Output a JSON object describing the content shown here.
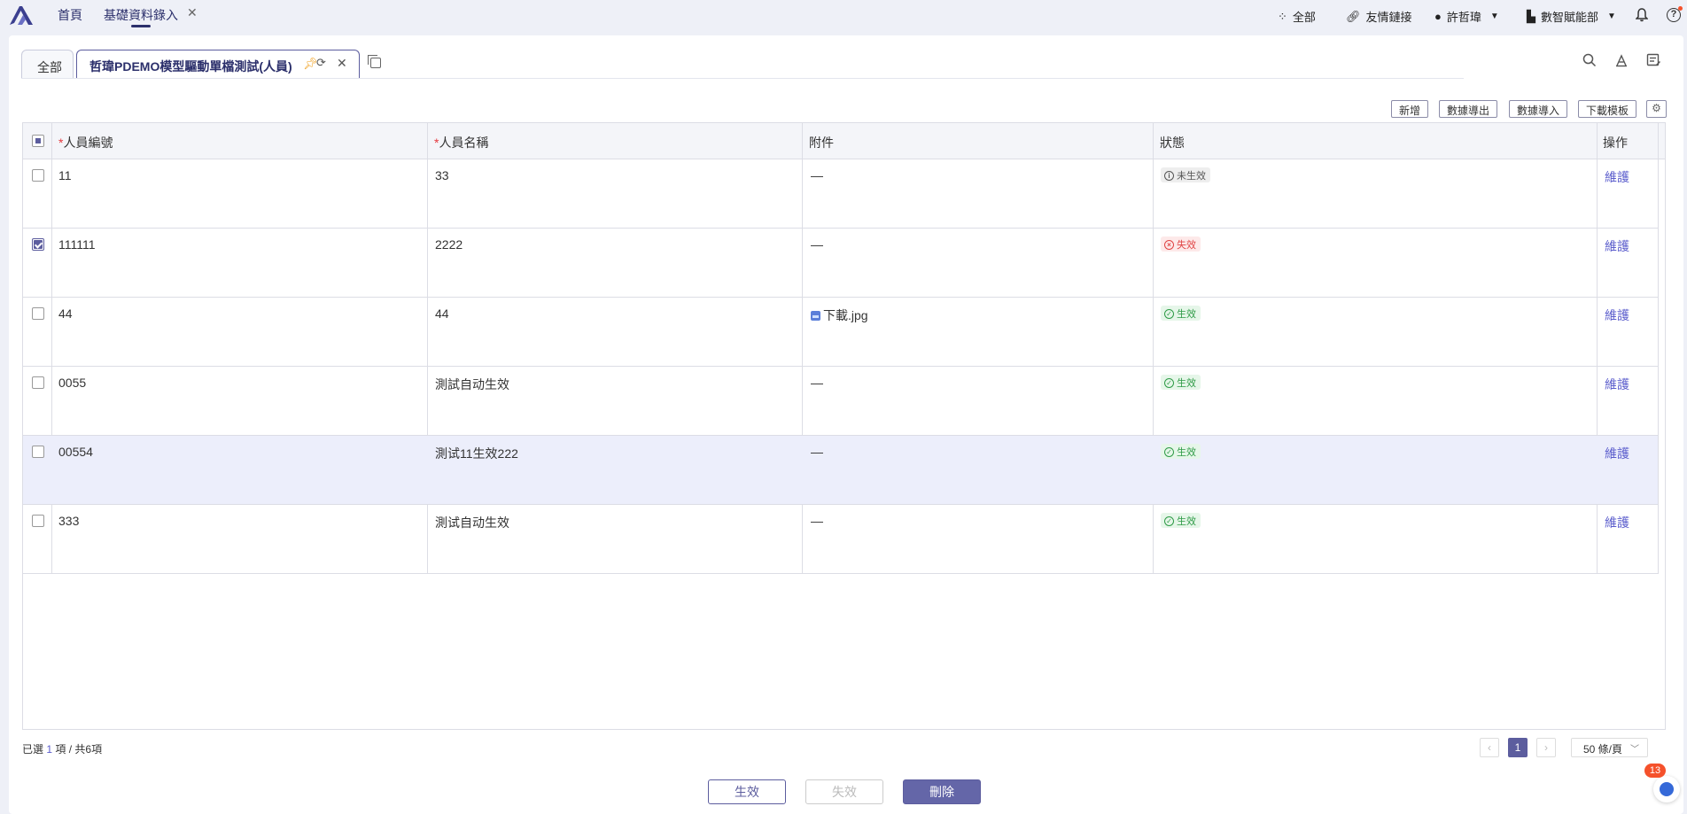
{
  "topbar": {
    "home": "首頁",
    "current_tab": "基礎資料錄入",
    "all": "全部",
    "links": "友情鏈接",
    "user": "許哲瑋",
    "department": "數智賦能部"
  },
  "tabs": {
    "all": "全部",
    "active": "哲瑋PDEMO模型驅動單檔測試(人員)"
  },
  "actions": {
    "add": "新增",
    "export": "數據導出",
    "import": "數據導入",
    "template": "下載模板"
  },
  "table": {
    "columns": [
      "人員編號",
      "人員名稱",
      "附件",
      "狀態",
      "操作"
    ],
    "required_mark": "*",
    "rows": [
      {
        "code": "11",
        "name": "33",
        "attachment": "—",
        "status": "未生效",
        "action": "維護"
      },
      {
        "code": "111111",
        "name": "2222",
        "attachment": "—",
        "status": "失效",
        "action": "維護"
      },
      {
        "code": "44",
        "name": "44",
        "attachment": "下載.jpg",
        "status": "生效",
        "action": "維護"
      },
      {
        "code": "0055",
        "name": "測試自动生效",
        "attachment": "—",
        "status": "生效",
        "action": "維護"
      },
      {
        "code": "00554",
        "name": "測试11生效222",
        "attachment": "—",
        "status": "生效",
        "action": "維護"
      },
      {
        "code": "333",
        "name": "測试自动生效",
        "attachment": "—",
        "status": "生效",
        "action": "維護"
      }
    ]
  },
  "footer": {
    "selected_prefix": "已選",
    "selected_count": "1",
    "selected_suffix": "項 / 共6項",
    "current_page": "1",
    "page_size": "50 條/頁",
    "btn_activate": "生效",
    "btn_deactivate": "失效",
    "btn_delete": "刪除",
    "chat_badge": "13"
  },
  "colors": {
    "primary": "#5c5d9e",
    "link": "#5a5ccc",
    "danger": "#e04343",
    "success": "#2e9b46"
  }
}
